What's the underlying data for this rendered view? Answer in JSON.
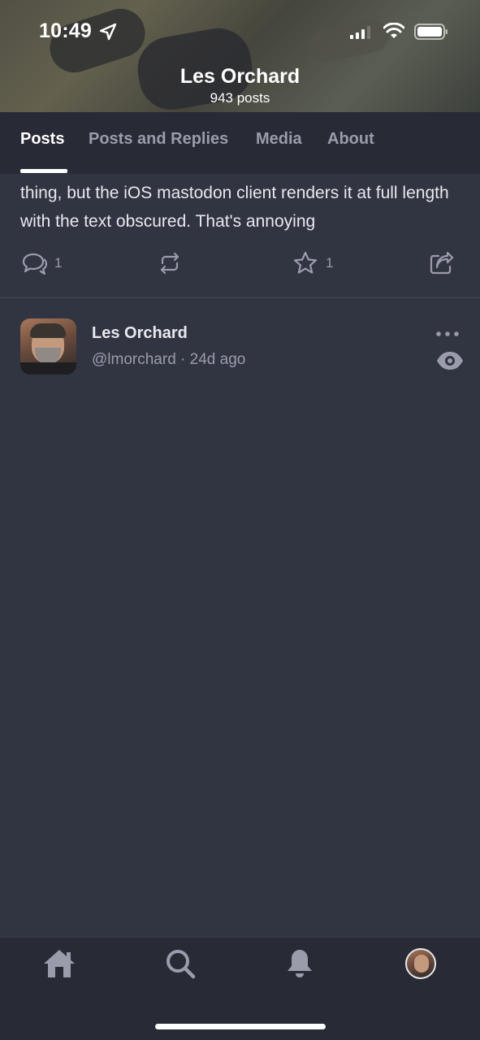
{
  "status_bar": {
    "time": "10:49"
  },
  "profile": {
    "name": "Les Orchard",
    "posts_count": "943 posts"
  },
  "tabs": [
    {
      "label": "Posts",
      "active": true
    },
    {
      "label": "Posts and Replies",
      "active": false
    },
    {
      "label": "Media",
      "active": false
    },
    {
      "label": "About",
      "active": false
    }
  ],
  "post1": {
    "text": "thing, but the iOS mastodon client renders it at full length with the text obscured. That's annoying",
    "reply_count": "1",
    "favorite_count": "1",
    "icons": [
      "reply-icon",
      "boost-icon",
      "star-icon",
      "share-icon"
    ]
  },
  "post2": {
    "author": "Les Orchard",
    "handle": "@lmorchard · 24d ago",
    "icons": [
      "more-icon",
      "eye-icon"
    ]
  },
  "bottom_nav": {
    "items": [
      "home-icon",
      "search-icon",
      "bell-icon",
      "profile-avatar"
    ]
  },
  "colors": {
    "background": "#313441",
    "bar": "#282a36",
    "muted": "#9a9cab",
    "text": "#e8e9ee"
  }
}
